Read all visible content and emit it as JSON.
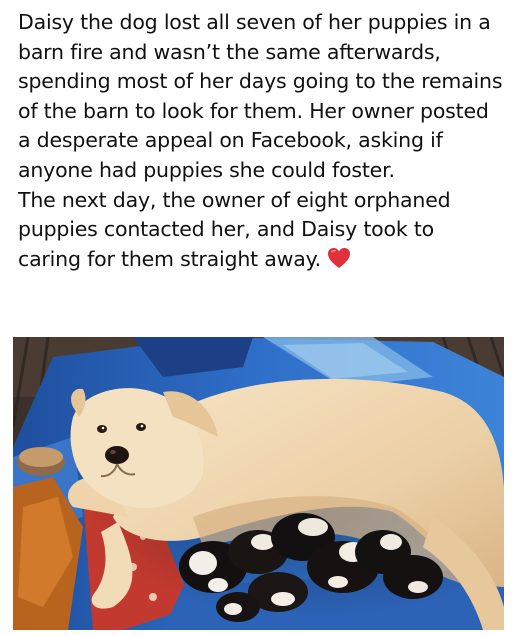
{
  "post": {
    "paragraph_1": "Daisy the dog lost all seven of her puppies in a barn fire and wasn’t the same afterwards, spending most of her days going to the remains of the barn to look for them. Her owner posted a desperate appeal on Facebook, asking if anyone had puppies she could foster.",
    "paragraph_2": "The next day, the owner of eight orphaned puppies contacted her, and Daisy took to caring for them straight away.",
    "emoji": "red-heart-icon"
  },
  "colors": {
    "text": "#111111",
    "heart": "#e0303a",
    "dog_fur": "#efd6b0",
    "blanket_blue": "#2f6fc9"
  }
}
